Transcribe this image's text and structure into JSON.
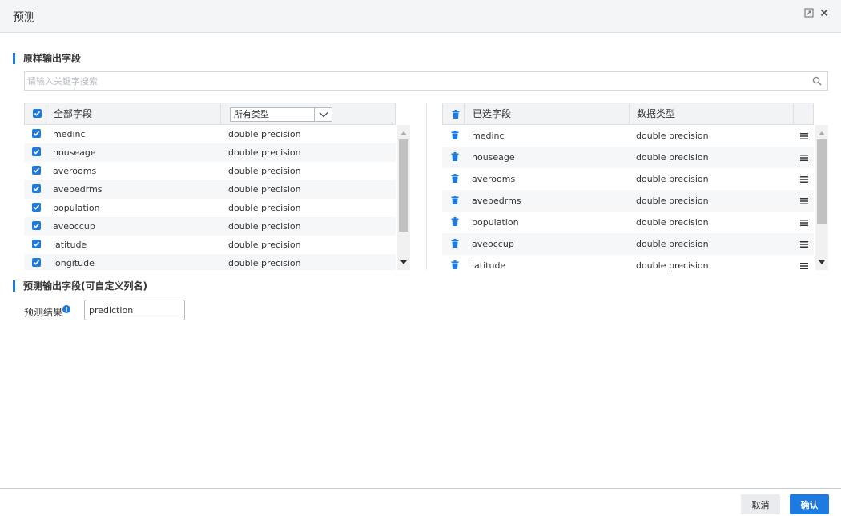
{
  "window": {
    "title": "预测",
    "maximize_icon": "maximize-icon",
    "close_icon": "close-icon"
  },
  "original_section": {
    "title": "原样输出字段",
    "search_placeholder": "请输入关键字搜索",
    "search_value": "",
    "search_icon": "search-icon"
  },
  "all_fields": {
    "header_label": "全部字段",
    "header_checked": true,
    "type_filter": "所有类型",
    "rows": [
      {
        "name": "medinc",
        "type": "double precision",
        "checked": true
      },
      {
        "name": "houseage",
        "type": "double precision",
        "checked": true
      },
      {
        "name": "averooms",
        "type": "double precision",
        "checked": true
      },
      {
        "name": "avebedrms",
        "type": "double precision",
        "checked": true
      },
      {
        "name": "population",
        "type": "double precision",
        "checked": true
      },
      {
        "name": "aveoccup",
        "type": "double precision",
        "checked": true
      },
      {
        "name": "latitude",
        "type": "double precision",
        "checked": true
      },
      {
        "name": "longitude",
        "type": "double precision",
        "checked": true
      }
    ]
  },
  "selected_fields": {
    "header_label": "已选字段",
    "type_header": "数据类型",
    "rows": [
      {
        "name": "medinc",
        "type": "double precision"
      },
      {
        "name": "houseage",
        "type": "double precision"
      },
      {
        "name": "averooms",
        "type": "double precision"
      },
      {
        "name": "avebedrms",
        "type": "double precision"
      },
      {
        "name": "population",
        "type": "double precision"
      },
      {
        "name": "aveoccup",
        "type": "double precision"
      },
      {
        "name": "latitude",
        "type": "double precision"
      }
    ]
  },
  "prediction_section": {
    "title": "预测输出字段(可自定义列名)",
    "result_label": "预测结果",
    "result_value": "prediction",
    "info_icon": "info-icon"
  },
  "footer": {
    "cancel_label": "取消",
    "ok_label": "确认"
  },
  "colors": {
    "accent": "#1c7ae0",
    "header_bg": "#f2f3f5",
    "stripe": "#f6f7f9"
  }
}
